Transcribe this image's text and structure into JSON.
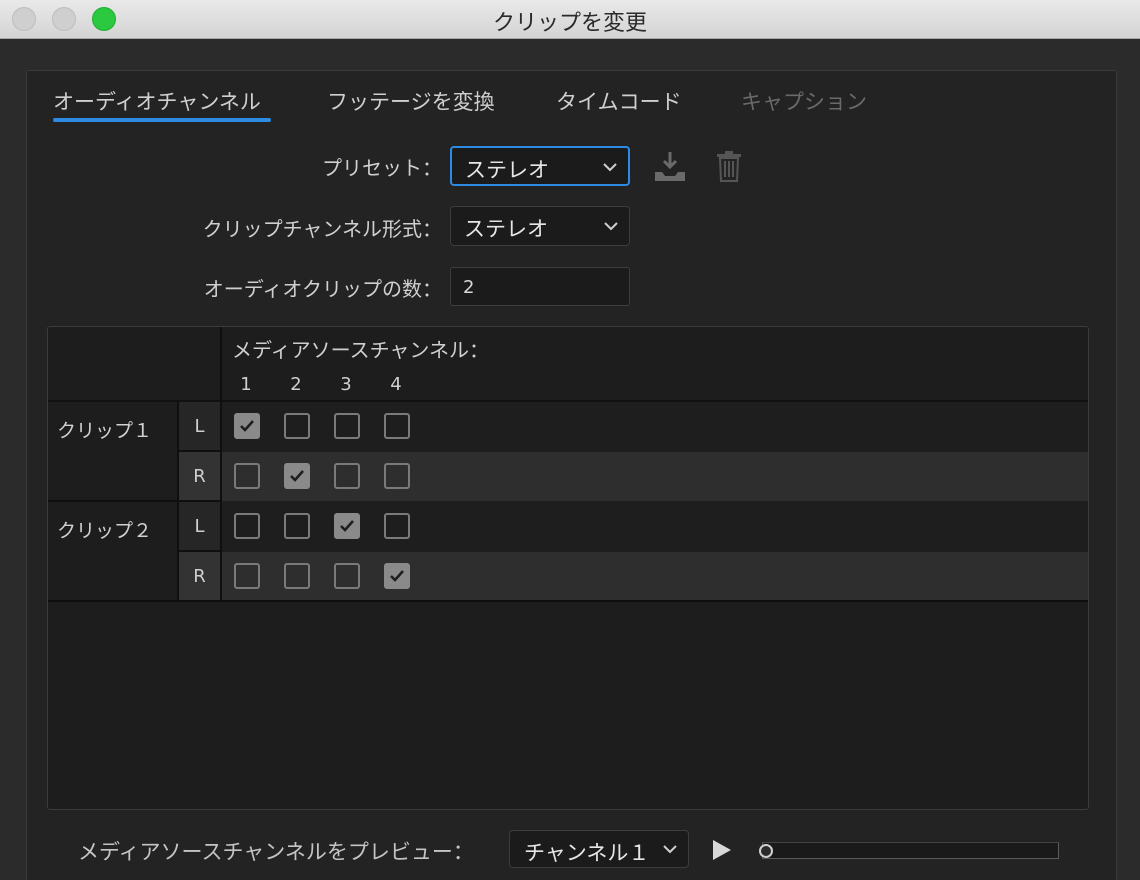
{
  "window": {
    "title": "クリップを変更"
  },
  "tabs": [
    {
      "label": "オーディオチャンネル",
      "active": true
    },
    {
      "label": "フッテージを変換",
      "active": false
    },
    {
      "label": "タイムコード",
      "active": false
    },
    {
      "label": "キャプション",
      "active": false,
      "disabled": true
    }
  ],
  "form": {
    "preset_label": "プリセット：",
    "preset_value": "ステレオ",
    "channel_format_label": "クリップチャンネル形式：",
    "channel_format_value": "ステレオ",
    "clip_count_label": "オーディオクリップの数：",
    "clip_count_value": "2"
  },
  "icons": {
    "save_preset": "download-icon",
    "delete_preset": "trash-icon"
  },
  "matrix": {
    "header": "メディアソースチャンネル：",
    "columns": [
      "1",
      "2",
      "3",
      "4"
    ],
    "clips": [
      {
        "label": "クリップ１",
        "rows": [
          {
            "channel": "L",
            "checked": [
              true,
              false,
              false,
              false
            ]
          },
          {
            "channel": "R",
            "checked": [
              false,
              true,
              false,
              false
            ]
          }
        ]
      },
      {
        "label": "クリップ２",
        "rows": [
          {
            "channel": "L",
            "checked": [
              false,
              false,
              true,
              false
            ]
          },
          {
            "channel": "R",
            "checked": [
              false,
              false,
              false,
              true
            ]
          }
        ]
      }
    ]
  },
  "footer": {
    "preview_label": "メディアソースチャンネルをプレビュー：",
    "preview_channel": "チャンネル１"
  },
  "colors": {
    "accent": "#2e8be4",
    "background": "#2b2b2b"
  }
}
